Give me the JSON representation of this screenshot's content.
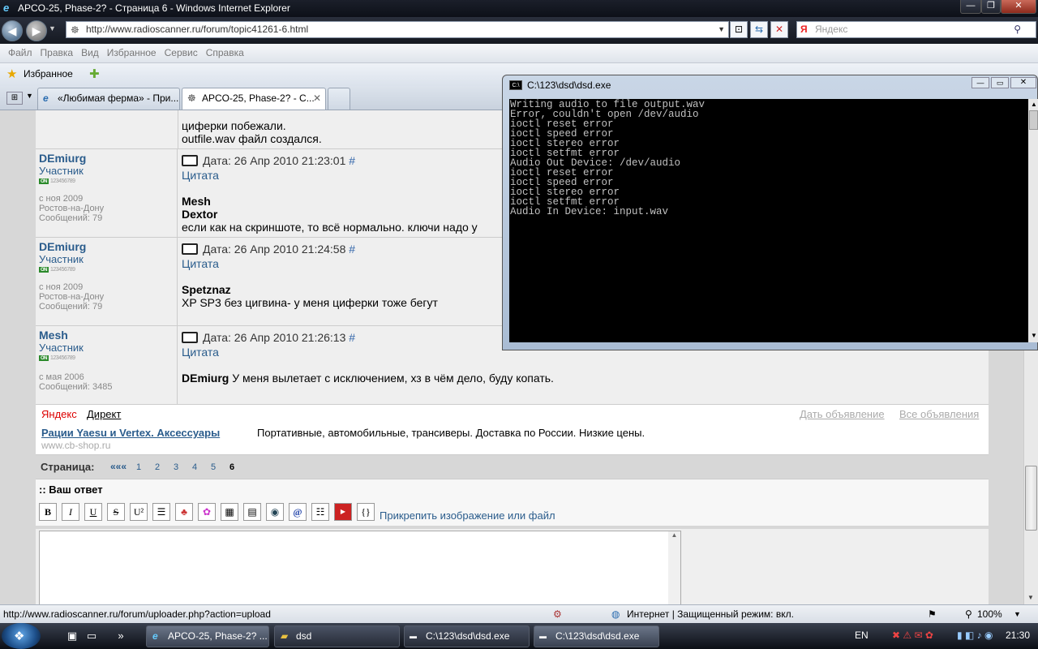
{
  "window": {
    "title": "APCO-25, Phase-2? - Страница 6 - Windows Internet Explorer",
    "min": "—",
    "max": "❐",
    "close": "✕"
  },
  "address": {
    "url": "http://www.radioscanner.ru/forum/topic41261-6.html",
    "search_placeholder": "Яндекс"
  },
  "menu": [
    "Файл",
    "Правка",
    "Вид",
    "Избранное",
    "Сервис",
    "Справка"
  ],
  "favorites": {
    "label": "Избранное"
  },
  "tabs": [
    {
      "label": "«Любимая ферма» - При..."
    },
    {
      "label": "APCO-25, Phase-2? - С..."
    }
  ],
  "posts": {
    "top_text_1": "циферки побежали.",
    "top_text_2": "outfile.wav файл создался.",
    "items": [
      {
        "user": "DEmiurg",
        "role": "Участник",
        "since": "с ноя 2009",
        "city": "Ростов-на-Дону",
        "msgs": "Сообщений: 79",
        "date": "Дата: 26 Апр 2010 21:23:01",
        "hash": "#",
        "quote": "Цитата",
        "line1": "Mesh",
        "line2": "Dextor",
        "line3": "если как на скриншоте, то всё нормально. ключи надо у"
      },
      {
        "user": "DEmiurg",
        "role": "Участник",
        "since": "с ноя 2009",
        "city": "Ростов-на-Дону",
        "msgs": "Сообщений: 79",
        "date": "Дата: 26 Апр 2010 21:24:58",
        "hash": "#",
        "quote": "Цитата",
        "line1": "Spetznaz",
        "line2": "XP SP3 без цигвина- у меня циферки тоже бегут"
      },
      {
        "user": "Mesh",
        "role": "Участник",
        "since": "с мая 2006",
        "msgs": "Сообщений: 3485",
        "date": "Дата: 26 Апр 2010 21:26:13",
        "hash": "#",
        "quote": "Цитата",
        "bold": "DEmiurg",
        "line2": "У меня вылетает с исключением, хз в чём дело, буду копать."
      }
    ],
    "rank_digits": "123456789"
  },
  "ads": {
    "yandex": "Яндекс",
    "direct": "Директ",
    "give_ad": "Дать объявление",
    "all_ads": "Все объявления",
    "link": "Рации Yaesu и Vertex. Аксессуары",
    "desc": "Портативные, автомобильные, трансиверы. Доставка по России. Низкие цены.",
    "site": "www.cb-shop.ru"
  },
  "pagination": {
    "label": "Страница:",
    "first": "«««",
    "pages": [
      "1",
      "2",
      "3",
      "4",
      "5",
      "6"
    ]
  },
  "reply": {
    "header": ":: Ваш ответ",
    "attach": "Прикрепить изображение или файл",
    "buttons": [
      "B",
      "I",
      "U",
      "S",
      "U²"
    ]
  },
  "console": {
    "title": "C:\\123\\dsd\\dsd.exe",
    "output": "Writing audio to file output.wav\nError, couldn't open /dev/audio\nioctl reset error\nioctl speed error\nioctl stereo error\nioctl setfmt error\nAudio Out Device: /dev/audio\nioctl reset error\nioctl speed error\nioctl stereo error\nioctl setfmt error\nAudio In Device: input.wav"
  },
  "status": {
    "url": "http://www.radioscanner.ru/forum/uploader.php?action=upload",
    "zone": "Интернет | Защищенный режим: вкл.",
    "zoom": "100%"
  },
  "taskbar": {
    "tasks": [
      "APCO-25, Phase-2? ...",
      "dsd",
      "C:\\123\\dsd\\dsd.exe",
      "C:\\123\\dsd\\dsd.exe"
    ],
    "lang": "EN",
    "time": "21:30"
  }
}
